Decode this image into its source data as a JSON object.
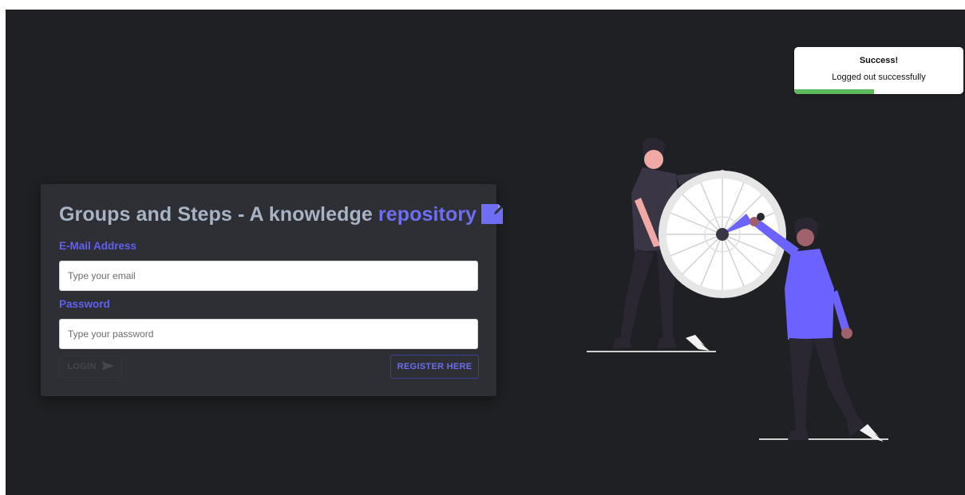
{
  "login": {
    "title_main": "Groups and Steps - A knowledge ",
    "title_accent": "repository",
    "email_label": "E-Mail Address",
    "email_placeholder": "Type your email",
    "email_value": "",
    "password_label": "Password",
    "password_placeholder": "Type your password",
    "password_value": "",
    "login_button": "LOGIN",
    "register_button": "REGISTER HERE"
  },
  "toast": {
    "title": "Success!",
    "message": "Logged out successfully",
    "progress": 0.47,
    "bar_color": "#5fba5f"
  },
  "colors": {
    "background": "#1f2023",
    "card": "#2e2f35",
    "accent": "#6e6ef2",
    "title_text": "#a8b3c4"
  },
  "icons": {
    "title_icon": "note-icon",
    "login_icon": "send-arrow-icon"
  }
}
